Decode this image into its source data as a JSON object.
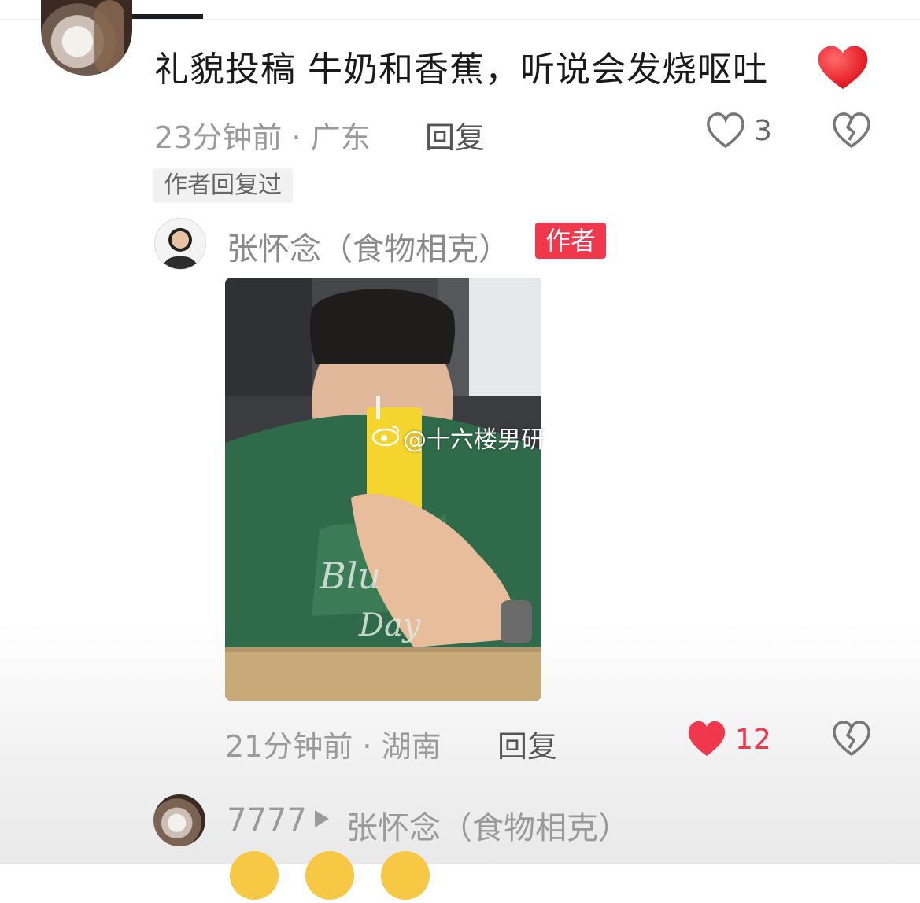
{
  "comment": {
    "text": "礼貌投稿 牛奶和香蕉，听说会发烧呕吐",
    "emoji": "red-heart",
    "time_location": "23分钟前 · 广东",
    "reply_label": "回复",
    "like_count": "3",
    "author_replied_tag": "作者回复过"
  },
  "reply": {
    "author_name": "张怀念（食物相克）",
    "author_badge": "作者",
    "image_watermark": "@十六楼男研",
    "time_location": "21分钟前 · 湖南",
    "reply_label": "回复",
    "like_count": "12",
    "liked": true
  },
  "sub_reply": {
    "username": "7777",
    "reply_to": "张怀念（食物相克）"
  },
  "colors": {
    "like_red": "#f0374c",
    "badge_red": "#f0374c",
    "meta_gray": "#9a9a9a"
  },
  "icons": [
    "heart-outline-icon",
    "broken-heart-icon",
    "heart-filled-icon",
    "weibo-logo-icon",
    "play-triangle-icon"
  ]
}
